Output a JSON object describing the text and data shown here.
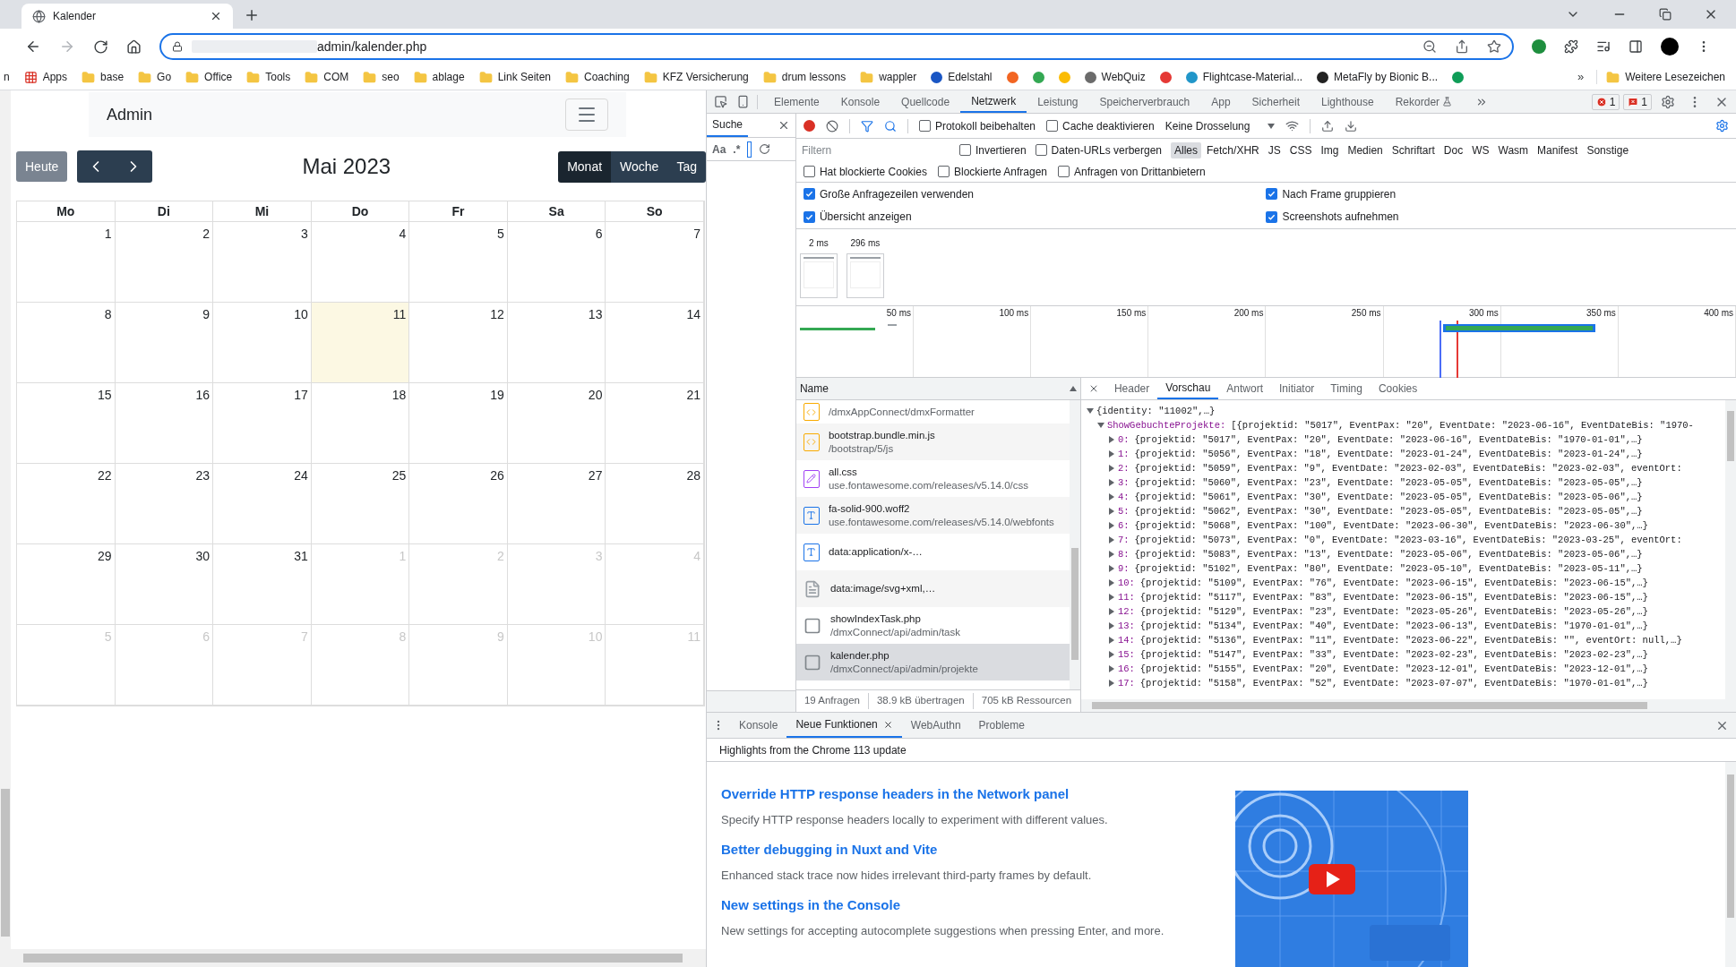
{
  "browser": {
    "tab_title": "Kalender",
    "url": "admin/kalender.php",
    "bookmarks": [
      {
        "kind": "plain",
        "label": "n"
      },
      {
        "kind": "apps",
        "label": "Apps"
      },
      {
        "kind": "folder",
        "label": "base"
      },
      {
        "kind": "folder",
        "label": "Go"
      },
      {
        "kind": "folder",
        "label": "Office"
      },
      {
        "kind": "folder",
        "label": "Tools"
      },
      {
        "kind": "folder",
        "label": "COM"
      },
      {
        "kind": "folder",
        "label": "seo"
      },
      {
        "kind": "folder",
        "label": "ablage"
      },
      {
        "kind": "folder",
        "label": "Link Seiten"
      },
      {
        "kind": "folder",
        "label": "Coaching"
      },
      {
        "kind": "folder",
        "label": "KFZ Versicherung"
      },
      {
        "kind": "folder",
        "label": "drum lessons"
      },
      {
        "kind": "folder",
        "label": "wappler"
      },
      {
        "kind": "site",
        "label": "Edelstahl",
        "color": "#1a56c4"
      },
      {
        "kind": "site",
        "color": "#f26522"
      },
      {
        "kind": "site",
        "color": "#34a853"
      },
      {
        "kind": "site",
        "color": "#fbbc04"
      },
      {
        "kind": "site",
        "label": "WebQuiz",
        "color": "#6b6b6b"
      },
      {
        "kind": "site",
        "color": "#e53935"
      },
      {
        "kind": "site",
        "label": "Flightcase-Material...",
        "color": "#2196c9"
      },
      {
        "kind": "site",
        "label": "MetaFly by Bionic B...",
        "color": "#222222"
      },
      {
        "kind": "site",
        "color": "#0f9d58"
      }
    ],
    "more_bookmarks": "»",
    "other_bookmarks": "Weitere Lesezeichen"
  },
  "calendar": {
    "brand": "Admin",
    "today_button": "Heute",
    "title": "Mai 2023",
    "views": [
      {
        "label": "Monat",
        "selected": true
      },
      {
        "label": "Woche",
        "selected": false
      },
      {
        "label": "Tag",
        "selected": false
      }
    ],
    "weekdays": [
      "Mo",
      "Di",
      "Mi",
      "Do",
      "Fr",
      "Sa",
      "So"
    ],
    "weeks": [
      [
        {
          "day": "1",
          "other_month": false,
          "today": false
        },
        {
          "day": "2",
          "other_month": false,
          "today": false
        },
        {
          "day": "3",
          "other_month": false,
          "today": false
        },
        {
          "day": "4",
          "other_month": false,
          "today": false
        },
        {
          "day": "5",
          "other_month": false,
          "today": false
        },
        {
          "day": "6",
          "other_month": false,
          "today": false
        },
        {
          "day": "7",
          "other_month": false,
          "today": false
        }
      ],
      [
        {
          "day": "8",
          "other_month": false,
          "today": false
        },
        {
          "day": "9",
          "other_month": false,
          "today": false
        },
        {
          "day": "10",
          "other_month": false,
          "today": false
        },
        {
          "day": "11",
          "other_month": false,
          "today": true
        },
        {
          "day": "12",
          "other_month": false,
          "today": false
        },
        {
          "day": "13",
          "other_month": false,
          "today": false
        },
        {
          "day": "14",
          "other_month": false,
          "today": false
        }
      ],
      [
        {
          "day": "15",
          "other_month": false,
          "today": false
        },
        {
          "day": "16",
          "other_month": false,
          "today": false
        },
        {
          "day": "17",
          "other_month": false,
          "today": false
        },
        {
          "day": "18",
          "other_month": false,
          "today": false
        },
        {
          "day": "19",
          "other_month": false,
          "today": false
        },
        {
          "day": "20",
          "other_month": false,
          "today": false
        },
        {
          "day": "21",
          "other_month": false,
          "today": false
        }
      ],
      [
        {
          "day": "22",
          "other_month": false,
          "today": false
        },
        {
          "day": "23",
          "other_month": false,
          "today": false
        },
        {
          "day": "24",
          "other_month": false,
          "today": false
        },
        {
          "day": "25",
          "other_month": false,
          "today": false
        },
        {
          "day": "26",
          "other_month": false,
          "today": false
        },
        {
          "day": "27",
          "other_month": false,
          "today": false
        },
        {
          "day": "28",
          "other_month": false,
          "today": false
        }
      ],
      [
        {
          "day": "29",
          "other_month": false,
          "today": false
        },
        {
          "day": "30",
          "other_month": false,
          "today": false
        },
        {
          "day": "31",
          "other_month": false,
          "today": false
        },
        {
          "day": "1",
          "other_month": true,
          "today": false
        },
        {
          "day": "2",
          "other_month": true,
          "today": false
        },
        {
          "day": "3",
          "other_month": true,
          "today": false
        },
        {
          "day": "4",
          "other_month": true,
          "today": false
        }
      ],
      [
        {
          "day": "5",
          "other_month": true,
          "today": false
        },
        {
          "day": "6",
          "other_month": true,
          "today": false
        },
        {
          "day": "7",
          "other_month": true,
          "today": false
        },
        {
          "day": "8",
          "other_month": true,
          "today": false
        },
        {
          "day": "9",
          "other_month": true,
          "today": false
        },
        {
          "day": "10",
          "other_month": true,
          "today": false
        },
        {
          "day": "11",
          "other_month": true,
          "today": false
        }
      ]
    ]
  },
  "devtools": {
    "tabs": [
      {
        "label": "Elemente",
        "selected": false,
        "experimental": false
      },
      {
        "label": "Konsole",
        "selected": false,
        "experimental": false
      },
      {
        "label": "Quellcode",
        "selected": false,
        "experimental": false
      },
      {
        "label": "Netzwerk",
        "selected": true,
        "experimental": false
      },
      {
        "label": "Leistung",
        "selected": false,
        "experimental": false
      },
      {
        "label": "Speicherverbrauch",
        "selected": false,
        "experimental": false
      },
      {
        "label": "App",
        "selected": false,
        "experimental": false
      },
      {
        "label": "Sicherheit",
        "selected": false,
        "experimental": false
      },
      {
        "label": "Lighthouse",
        "selected": false,
        "experimental": false
      },
      {
        "label": "Rekorder",
        "selected": false,
        "experimental": true
      }
    ],
    "error_count": "1",
    "issue_count": "1",
    "search": {
      "title": "Suche",
      "case_toggle": "Aa",
      "regex_toggle": ".*"
    },
    "toolbar": {
      "checkboxes": [
        {
          "label": "Protokoll beibehalten",
          "checked": false
        },
        {
          "label": "Cache deaktivieren",
          "checked": false
        }
      ],
      "throttling": "Keine Drosselung"
    },
    "filter": {
      "placeholder": "Filtern",
      "checkboxes": [
        {
          "label": "Invertieren",
          "checked": false
        },
        {
          "label": "Daten-URLs verbergen",
          "checked": false
        }
      ],
      "types": [
        {
          "label": "Alles",
          "selected": true
        },
        {
          "label": "Fetch/XHR",
          "selected": false
        },
        {
          "label": "JS",
          "selected": false
        },
        {
          "label": "CSS",
          "selected": false
        },
        {
          "label": "Img",
          "selected": false
        },
        {
          "label": "Medien",
          "selected": false
        },
        {
          "label": "Schriftart",
          "selected": false
        },
        {
          "label": "Doc",
          "selected": false
        },
        {
          "label": "WS",
          "selected": false
        },
        {
          "label": "Wasm",
          "selected": false
        },
        {
          "label": "Manifest",
          "selected": false
        },
        {
          "label": "Sonstige",
          "selected": false
        }
      ],
      "more_checkboxes": [
        {
          "label": "Hat blockierte Cookies",
          "checked": false
        },
        {
          "label": "Blockierte Anfragen",
          "checked": false
        },
        {
          "label": "Anfragen von Drittanbietern",
          "checked": false
        }
      ]
    },
    "settings": [
      {
        "label": "Große Anfragezeilen verwenden",
        "checked": true
      },
      {
        "label": "Nach Frame gruppieren",
        "checked": true
      },
      {
        "label": "Übersicht anzeigen",
        "checked": true
      },
      {
        "label": "Screenshots aufnehmen",
        "checked": true
      }
    ],
    "screenshots": [
      "2 ms",
      "296 ms"
    ],
    "timeline_ticks": [
      "50 ms",
      "100 ms",
      "150 ms",
      "200 ms",
      "250 ms",
      "300 ms",
      "350 ms",
      "400 ms"
    ],
    "requests_header": "Name",
    "requests": [
      {
        "kind": "script",
        "path": "/dmxAppConnect/dmxFormatter",
        "selected": false
      },
      {
        "kind": "script",
        "name": "bootstrap.bundle.min.js",
        "path": "/bootstrap/5/js",
        "selected": false
      },
      {
        "kind": "style",
        "name": "all.css",
        "path": "use.fontawesome.com/releases/v5.14.0/css",
        "selected": false
      },
      {
        "kind": "font",
        "name": "fa-solid-900.woff2",
        "path": "use.fontawesome.com/releases/v5.14.0/webfonts",
        "selected": false
      },
      {
        "kind": "font",
        "name": "data:application/x-…",
        "selected": false
      },
      {
        "kind": "doc",
        "name": "data:image/svg+xml,…",
        "selected": false
      },
      {
        "kind": "blank",
        "name": "showIndexTask.php",
        "path": "/dmxConnect/api/admin/task",
        "selected": false
      },
      {
        "kind": "blank",
        "name": "kalender.php",
        "path": "/dmxConnect/api/admin/projekte",
        "selected": true
      }
    ],
    "summary": [
      "19 Anfragen",
      "38.9 kB übertragen",
      "705 kB Ressourcen"
    ],
    "detail_tabs": [
      {
        "label": "Header",
        "selected": false
      },
      {
        "label": "Vorschau",
        "selected": true
      },
      {
        "label": "Antwort",
        "selected": false
      },
      {
        "label": "Initiator",
        "selected": false
      },
      {
        "label": "Timing",
        "selected": false
      },
      {
        "label": "Cookies",
        "selected": false
      }
    ],
    "preview": {
      "root": "{identity: \"11002\",…}",
      "key": "ShowGebuchteProjekte:",
      "key_value": "[{projektid: \"5017\", EventPax: \"20\", EventDate: \"2023-06-16\", EventDateBis: \"1970-",
      "items": [
        {
          "index": "0:",
          "text": "{projektid: \"5017\", EventPax: \"20\", EventDate: \"2023-06-16\", EventDateBis: \"1970-01-01\",…}"
        },
        {
          "index": "1:",
          "text": "{projektid: \"5056\", EventPax: \"18\", EventDate: \"2023-01-24\", EventDateBis: \"2023-01-24\",…}"
        },
        {
          "index": "2:",
          "text": "{projektid: \"5059\", EventPax: \"9\", EventDate: \"2023-02-03\", EventDateBis: \"2023-02-03\", eventOrt:"
        },
        {
          "index": "3:",
          "text": "{projektid: \"5060\", EventPax: \"23\", EventDate: \"2023-05-05\", EventDateBis: \"2023-05-05\",…}"
        },
        {
          "index": "4:",
          "text": "{projektid: \"5061\", EventPax: \"30\", EventDate: \"2023-05-05\", EventDateBis: \"2023-05-06\",…}"
        },
        {
          "index": "5:",
          "text": "{projektid: \"5062\", EventPax: \"30\", EventDate: \"2023-05-05\", EventDateBis: \"2023-05-05\",…}"
        },
        {
          "index": "6:",
          "text": "{projektid: \"5068\", EventPax: \"100\", EventDate: \"2023-06-30\", EventDateBis: \"2023-06-30\",…}"
        },
        {
          "index": "7:",
          "text": "{projektid: \"5073\", EventPax: \"0\", EventDate: \"2023-03-16\", EventDateBis: \"2023-03-25\", eventOrt:"
        },
        {
          "index": "8:",
          "text": "{projektid: \"5083\", EventPax: \"13\", EventDate: \"2023-05-06\", EventDateBis: \"2023-05-06\",…}"
        },
        {
          "index": "9:",
          "text": "{projektid: \"5102\", EventPax: \"80\", EventDate: \"2023-05-10\", EventDateBis: \"2023-05-11\",…}"
        },
        {
          "index": "10:",
          "text": "{projektid: \"5109\", EventPax: \"76\", EventDate: \"2023-06-15\", EventDateBis: \"2023-06-15\",…}"
        },
        {
          "index": "11:",
          "text": "{projektid: \"5117\", EventPax: \"83\", EventDate: \"2023-06-15\", EventDateBis: \"2023-06-15\",…}"
        },
        {
          "index": "12:",
          "text": "{projektid: \"5129\", EventPax: \"23\", EventDate: \"2023-05-26\", EventDateBis: \"2023-05-26\",…}"
        },
        {
          "index": "13:",
          "text": "{projektid: \"5134\", EventPax: \"40\", EventDate: \"2023-06-13\", EventDateBis: \"1970-01-01\",…}"
        },
        {
          "index": "14:",
          "text": "{projektid: \"5136\", EventPax: \"11\", EventDate: \"2023-06-22\", EventDateBis: \"\", eventOrt: null,…}"
        },
        {
          "index": "15:",
          "text": "{projektid: \"5147\", EventPax: \"33\", EventDate: \"2023-02-23\", EventDateBis: \"2023-02-23\",…}"
        },
        {
          "index": "16:",
          "text": "{projektid: \"5155\", EventPax: \"20\", EventDate: \"2023-12-01\", EventDateBis: \"2023-12-01\",…}"
        },
        {
          "index": "17:",
          "text": "{projektid: \"5158\", EventPax: \"52\", EventDate: \"2023-07-07\", EventDateBis: \"1970-01-01\",…}"
        }
      ]
    },
    "drawer": {
      "tabs": [
        {
          "label": "Konsole",
          "selected": false,
          "closable": false
        },
        {
          "label": "Neue Funktionen",
          "selected": true,
          "closable": true
        },
        {
          "label": "WebAuthn",
          "selected": false,
          "closable": false
        },
        {
          "label": "Probleme",
          "selected": false,
          "closable": false
        }
      ],
      "header": "Highlights from the Chrome 113 update",
      "features": [
        {
          "title": "Override HTTP response headers in the Network panel",
          "text": "Specify HTTP response headers locally to experiment with different values."
        },
        {
          "title": "Better debugging in Nuxt and Vite",
          "text": "Enhanced stack trace now hides irrelevant third-party frames by default."
        },
        {
          "title": "New settings in the Console",
          "text": "New settings for accepting autocomplete suggestions when pressing Enter, and more."
        }
      ]
    }
  }
}
